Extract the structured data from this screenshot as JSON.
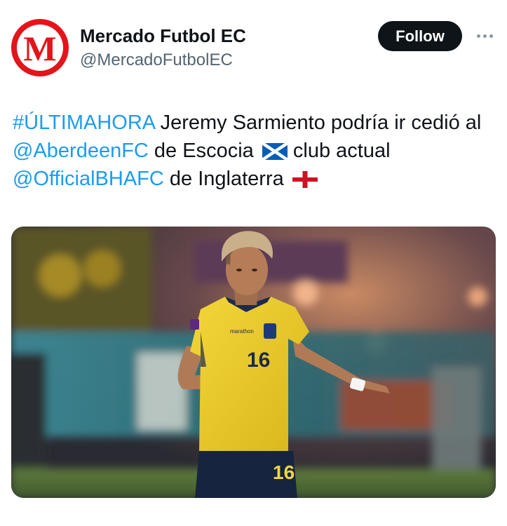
{
  "author": {
    "display_name": "Mercado Futbol EC",
    "handle": "@MercadoFutbolEC",
    "avatar_letter": "M",
    "avatar_color": "#e4141b"
  },
  "actions": {
    "follow_label": "Follow",
    "more_icon": "more-horizontal-icon"
  },
  "tweet": {
    "hashtag": "#ÚLTIMAHORA",
    "text_1": " Jeremy Sarmiento podría ir cedió al ",
    "mention_1": "@AberdeenFC",
    "text_2": " de Escocia ",
    "flag_1": "scotland-flag-icon",
    "text_3": " club actual ",
    "mention_2": "@OfficialBHAFC",
    "text_4": " de Inglaterra ",
    "flag_2": "england-flag-icon"
  },
  "media": {
    "type": "photo",
    "shirt_number": "16",
    "shirt_sponsor": "marathon"
  },
  "colors": {
    "link": "#1d9bf0",
    "text": "#0f1419",
    "secondary": "#536471",
    "follow_bg": "#0f1419"
  }
}
